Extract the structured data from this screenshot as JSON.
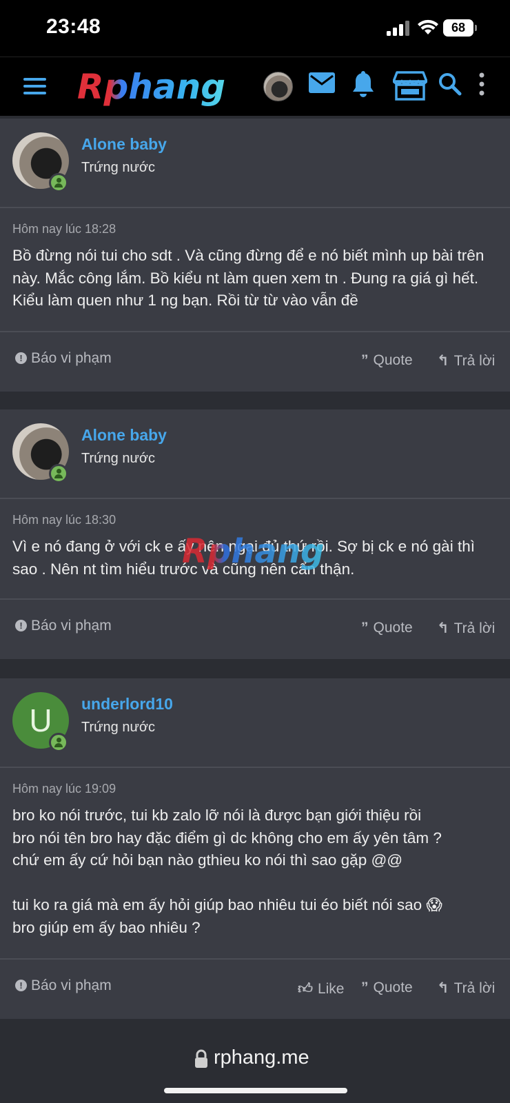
{
  "status_bar": {
    "time": "23:48",
    "battery": "68"
  },
  "header": {
    "logo_text": "Rphang"
  },
  "posts": [
    {
      "username": "Alone baby",
      "user_title": "Trứng nước",
      "timestamp": "Hôm nay lúc 18:28",
      "message": "Bồ đừng nói tui cho sdt . Và cũng đừng để e nó biết mình up bài trên này. Mắc công lắm. Bồ kiểu nt làm quen xem tn . Đung ra giá gì hết. Kiểu làm quen như 1 ng bạn. Rồi từ từ vào vẫn đề",
      "report_label": "Báo vi phạm",
      "quote_label": "Quote",
      "reply_label": "Trả lời"
    },
    {
      "username": "Alone baby",
      "user_title": "Trứng nước",
      "timestamp": "Hôm nay lúc 18:30",
      "message": "Vì e nó đang ở với ck e ấy nên ngại đủ thứ rồi. Sợ bị ck e nó gài thì sao . Nên nt tìm hiểu trước và cũng nên cẩn thận.",
      "report_label": "Báo vi phạm",
      "quote_label": "Quote",
      "reply_label": "Trả lời"
    },
    {
      "username": "underlord10",
      "avatar_letter": "U",
      "user_title": "Trứng nước",
      "timestamp": "Hôm nay lúc 19:09",
      "message": "bro ko nói trước, tui kb zalo lỡ nói là được bạn giới thiệu rồi\nbro nói tên bro hay đặc điểm gì dc không cho em ấy yên tâm ?\nchứ em ấy cứ hỏi bạn nào gthieu ko nói thì sao gặp @@\n\ntui ko ra giá mà em ấy hỏi giúp bao nhiêu tui éo biết nói sao 😱\nbro giúp em ấy bao nhiêu ?",
      "report_label": "Báo vi phạm",
      "like_label": "Like",
      "quote_label": "Quote",
      "reply_label": "Trả lời"
    }
  ],
  "watermark": "Rphang",
  "url_bar": {
    "domain": "rphang.me"
  },
  "colors": {
    "username": "#47a7eb",
    "online": "#77b95a",
    "card": "#3a3c44",
    "page": "#2b2d33"
  }
}
